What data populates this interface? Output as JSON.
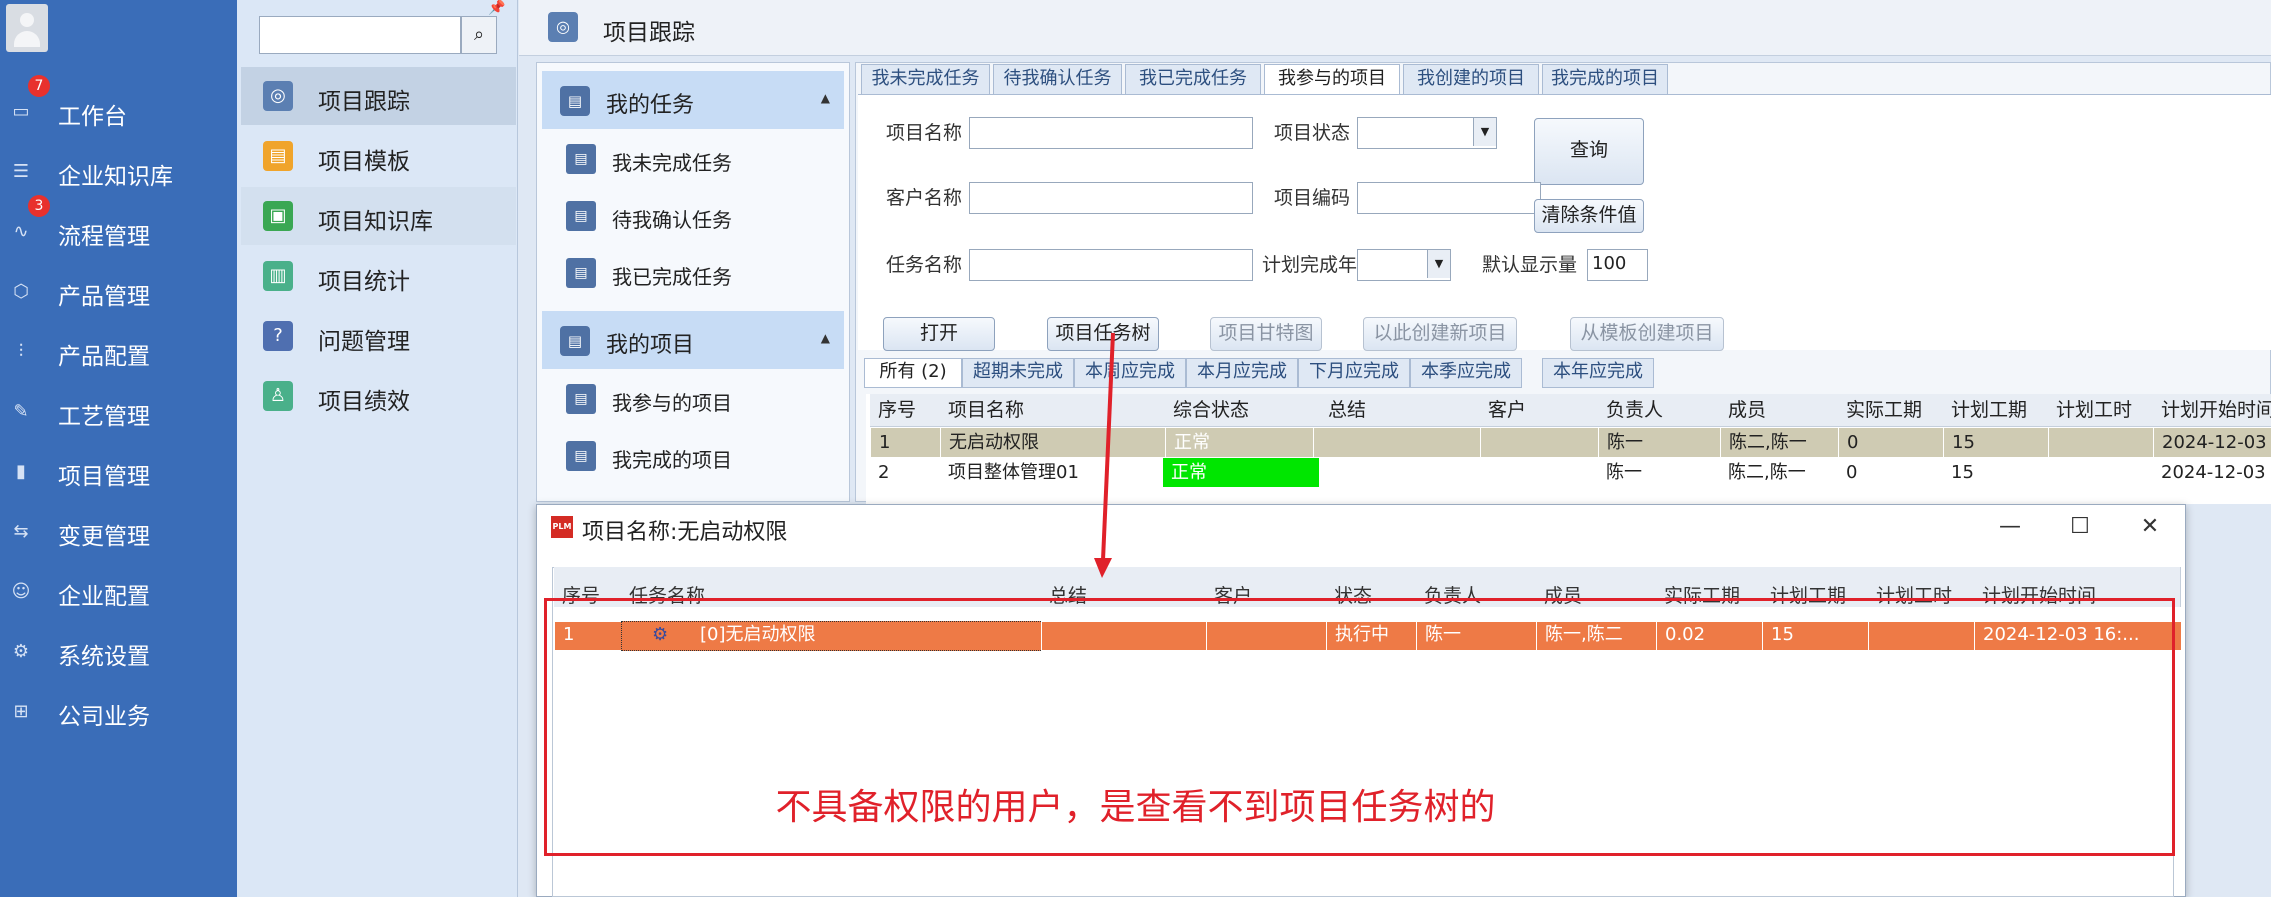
{
  "nav": {
    "items": [
      {
        "label": "工作台",
        "icon": "monitor-icon",
        "badge": "7"
      },
      {
        "label": "企业知识库",
        "icon": "book-icon",
        "badge": ""
      },
      {
        "label": "流程管理",
        "icon": "flow-icon",
        "badge": "3"
      },
      {
        "label": "产品管理",
        "icon": "box-icon",
        "badge": ""
      },
      {
        "label": "产品配置",
        "icon": "sliders-icon",
        "badge": ""
      },
      {
        "label": "工艺管理",
        "icon": "wrench-icon",
        "badge": ""
      },
      {
        "label": "项目管理",
        "icon": "chart-icon",
        "badge": ""
      },
      {
        "label": "变更管理",
        "icon": "change-icon",
        "badge": ""
      },
      {
        "label": "企业配置",
        "icon": "users-icon",
        "badge": ""
      },
      {
        "label": "系统设置",
        "icon": "gear-icon",
        "badge": ""
      },
      {
        "label": "公司业务",
        "icon": "grid-icon",
        "badge": ""
      }
    ]
  },
  "panel2": {
    "items": [
      {
        "label": "项目跟踪",
        "icon": "location-icon",
        "color": "#5b7fb2"
      },
      {
        "label": "项目模板",
        "icon": "template-icon",
        "color": "#f0a42b"
      },
      {
        "label": "项目知识库",
        "icon": "knowledge-icon",
        "color": "#3aa753"
      },
      {
        "label": "项目统计",
        "icon": "stats-icon",
        "color": "#4ab08a"
      },
      {
        "label": "问题管理",
        "icon": "question-icon",
        "color": "#4f6fb0"
      },
      {
        "label": "项目绩效",
        "icon": "performance-icon",
        "color": "#4ab08a"
      }
    ]
  },
  "header": {
    "title": "项目跟踪"
  },
  "tree": {
    "my_tasks": "我的任务",
    "task_items": [
      "我未完成任务",
      "待我确认任务",
      "我已完成任务"
    ],
    "my_projects": "我的项目",
    "project_items": [
      "我参与的项目",
      "我完成的项目"
    ]
  },
  "tabs": [
    "我未完成任务",
    "待我确认任务",
    "我已完成任务",
    "我参与的项目",
    "我创建的项目",
    "我完成的项目"
  ],
  "form": {
    "project_name": "项目名称",
    "project_status": "项目状态",
    "customer_name": "客户名称",
    "project_code": "项目编码",
    "task_name": "任务名称",
    "plan_year": "计划完成年",
    "default_count_label": "默认显示量",
    "default_count": "100",
    "query": "查询",
    "clear": "清除条件值"
  },
  "actions": {
    "open": "打开",
    "task_tree": "项目任务树",
    "gantt": "项目甘特图",
    "create_new": "以此创建新项目",
    "from_template": "从模板创建项目"
  },
  "subtabs": [
    "所有 (2)",
    "超期未完成",
    "本周应完成",
    "本月应完成",
    "下月应完成",
    "本季应完成",
    "本年应完成"
  ],
  "grid": {
    "headers": [
      "序号",
      "项目名称",
      "综合状态",
      "总结",
      "客户",
      "负责人",
      "成员",
      "实际工期",
      "计划工期",
      "计划工时",
      "计划开始时间"
    ],
    "rows": [
      [
        "1",
        "无启动权限",
        "正常",
        "",
        "",
        "陈一",
        "陈二,陈一",
        "0",
        "15",
        "",
        "2024-12-03"
      ],
      [
        "2",
        "项目整体管理01",
        "正常",
        "",
        "",
        "陈一",
        "陈二,陈一",
        "0",
        "15",
        "",
        "2024-12-03"
      ]
    ],
    "status_color": "#00e600"
  },
  "dialog": {
    "title": "项目名称:无启动权限",
    "headers": [
      "序号",
      "任务名称",
      "总结",
      "客户",
      "状态",
      "负责人",
      "成员",
      "实际工期",
      "计划工期",
      "计划工时",
      "计划开始时间"
    ],
    "row": [
      "1",
      "[0]无启动权限",
      "",
      "",
      "执行中",
      "陈一",
      "陈一,陈二",
      "0.02",
      "15",
      "",
      "2024-12-03 16:..."
    ],
    "row_color": "#ee7a46"
  },
  "annotation": "不具备权限的用户，是查看不到项目任务树的",
  "colors": {
    "nav_bg": "#3a6db8",
    "annotation_red": "#e0212a"
  }
}
